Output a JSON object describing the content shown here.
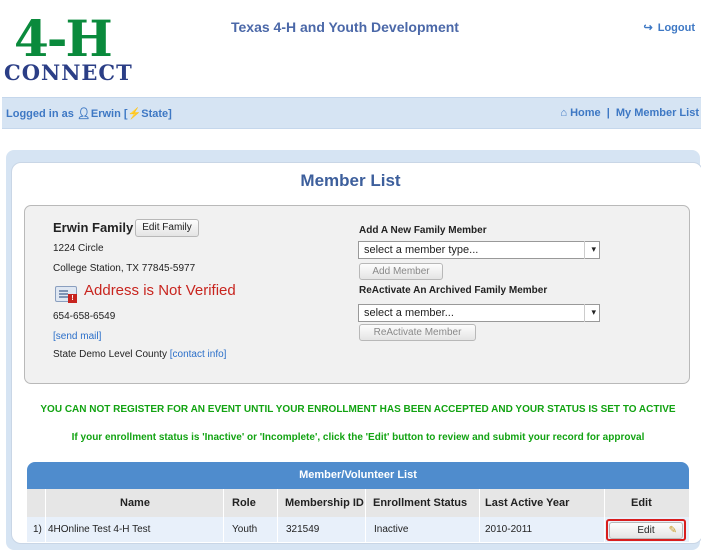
{
  "header": {
    "logo_text": "4-H",
    "logo_sub": "CONNECT",
    "site_title": "Texas 4-H and Youth Development",
    "logout_label": "Logout"
  },
  "navbar": {
    "logged_prefix": "Logged in as",
    "user_name": "Erwin",
    "role_tag": "[⚡State]",
    "home_label": "Home",
    "separator": "|",
    "member_list_link": "My Member List"
  },
  "page_title": "Member List",
  "family": {
    "name": "Erwin Family",
    "edit_button": "Edit Family",
    "street": "1224 Circle",
    "city_state_zip": "College Station, TX 77845-5977",
    "address_warning": "Address is Not Verified",
    "phone": "654-658-6549",
    "send_mail": "[send mail]",
    "county": "State Demo Level County",
    "contact_info": "[contact info]"
  },
  "add_member": {
    "heading": "Add A New Family Member",
    "select_value": "select a member type...",
    "button": "Add Member"
  },
  "reactivate": {
    "heading": "ReActivate An Archived Family Member",
    "select_value": "select a member...",
    "button": "ReActivate Member"
  },
  "notices": {
    "line1": "YOU CAN NOT REGISTER FOR AN EVENT UNTIL YOUR ENROLLMENT HAS BEEN ACCEPTED AND YOUR STATUS IS SET TO ACTIVE",
    "line2": "If your enrollment status is 'Inactive' or 'Incomplete', click the 'Edit' button to review and submit your record for approval"
  },
  "table": {
    "title": "Member/Volunteer List",
    "columns": [
      "",
      "Name",
      "Role",
      "Membership ID",
      "Enrollment Status",
      "Last Active Year",
      "Edit"
    ],
    "rows": [
      {
        "index": "1)",
        "name": "4HOnline Test 4-H Test",
        "role": "Youth",
        "membership_id": "321549",
        "status": "Inactive",
        "last_active_year": "2010-2011",
        "edit_label": "Edit"
      }
    ]
  },
  "colors": {
    "accent_blue": "#4f8ccd",
    "link_blue": "#3e78c4",
    "warning_red": "#c8251f",
    "notice_green": "#12a312",
    "logo_green": "#0a8a3c"
  },
  "icons": {
    "logout": "logout-icon",
    "user": "user-icon",
    "home": "home-icon",
    "address_card": "address-card-icon",
    "pencil": "pencil-icon"
  }
}
